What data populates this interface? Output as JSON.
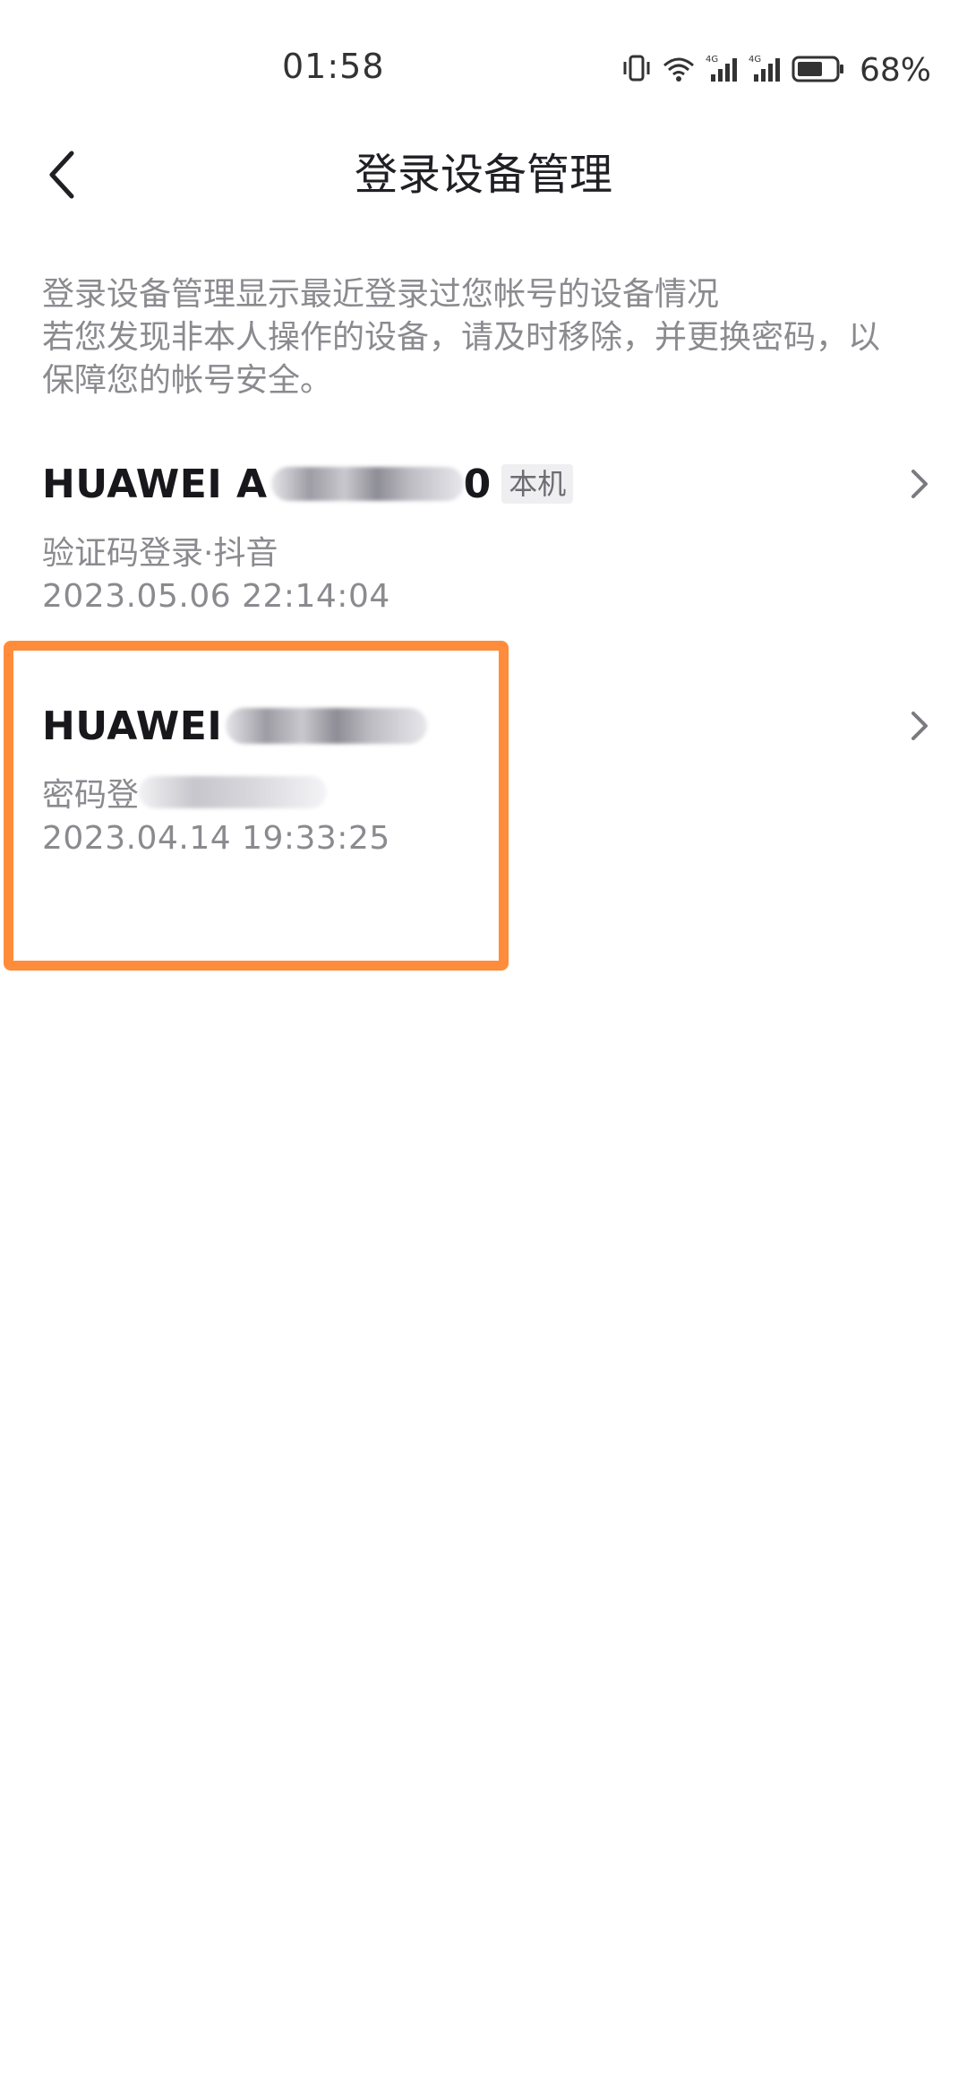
{
  "status_bar": {
    "time": "01:58",
    "battery_percent": "68%",
    "network_1": "4G",
    "network_2": "4G",
    "battery_level": 0.68
  },
  "header": {
    "title": "登录设备管理"
  },
  "description": {
    "line1": "登录设备管理显示最近登录过您帐号的设备情况",
    "line2": "若您发现非本人操作的设备，请及时移除，并更换密码，以",
    "line3": "保障您的帐号安全。"
  },
  "devices": [
    {
      "name_prefix": "HUAWEI A",
      "name_suffix": "0",
      "badge": "本机",
      "login_method": "验证码登录·抖音",
      "time": "2023.05.06 22:14:04"
    },
    {
      "name_prefix": "HUAWEI",
      "login_method_prefix": "密码登",
      "time": "2023.04.14 19:33:25"
    }
  ],
  "colors": {
    "highlight": "#ff8c3a",
    "text_primary": "#17171c",
    "text_secondary": "#8a8a8f"
  }
}
